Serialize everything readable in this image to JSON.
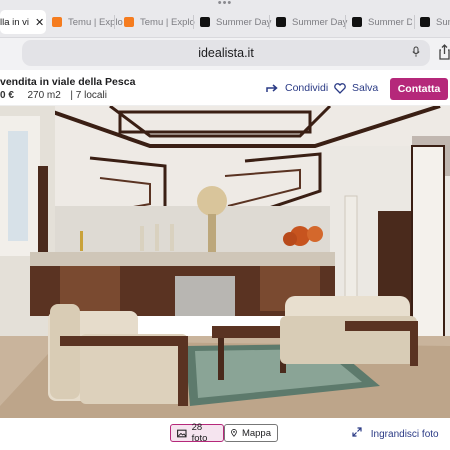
{
  "browser": {
    "tabs": [
      {
        "label": "lla in vi",
        "active": true
      },
      {
        "label": "Temu | Explo",
        "favicon": "temu-icon"
      },
      {
        "label": "Temu | Explo",
        "favicon": "temu-icon"
      },
      {
        "label": "Summer Day",
        "favicon": "summer-day-icon"
      },
      {
        "label": "Summer Day",
        "favicon": "summer-day-icon"
      },
      {
        "label": "Summer Day",
        "favicon": "summer-day-icon"
      },
      {
        "label": "Summ",
        "favicon": "summer-day-icon"
      }
    ],
    "close_glyph": "✕",
    "menu_dots": "•••",
    "address": "idealista.it"
  },
  "listing": {
    "title": "vendita in viale della Pesca",
    "price": "0 €",
    "area": "270 m2",
    "separator": "|",
    "rooms": "7 locali"
  },
  "actions": {
    "share_label": "Condividi",
    "save_label": "Salva",
    "contact_label": "Contatta"
  },
  "gallery": {
    "photos_label": "28 foto",
    "map_label": "Mappa",
    "enlarge_label": "Ingrandisci foto"
  },
  "colors": {
    "accent": "#b5287a",
    "link": "#2a3a85"
  }
}
